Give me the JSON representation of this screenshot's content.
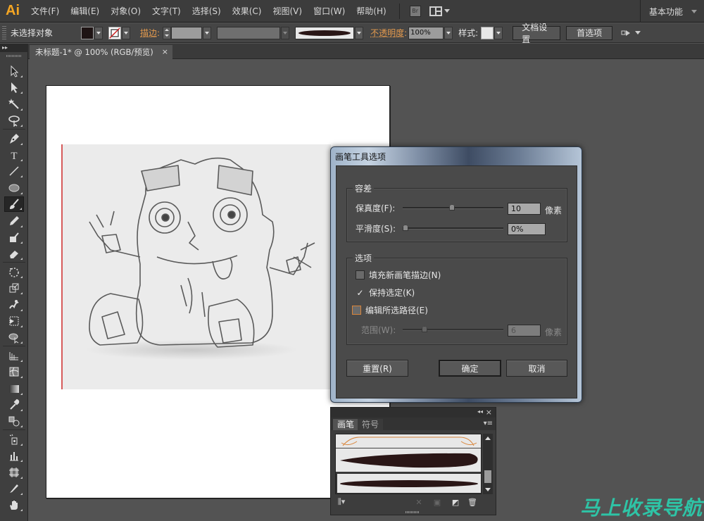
{
  "app": {
    "logo": "Ai"
  },
  "menu": {
    "items": [
      "文件(F)",
      "编辑(E)",
      "对象(O)",
      "文字(T)",
      "选择(S)",
      "效果(C)",
      "视图(V)",
      "窗口(W)",
      "帮助(H)"
    ],
    "bridge_label": "Br",
    "workspace": "基本功能"
  },
  "control_bar": {
    "selection_status": "未选择对象",
    "fill_color": "#1e1414",
    "stroke_label": "描边",
    "opacity_label": "不透明度",
    "opacity_value": "100%",
    "style_label": "样式",
    "doc_setup_button": "文档设置",
    "preferences_button": "首选项"
  },
  "document_tab": {
    "title": "未标题-1* @ 100% (RGB/预览)",
    "close": "×"
  },
  "tools": [
    {
      "name": "selection-tool"
    },
    {
      "name": "direct-selection-tool"
    },
    {
      "name": "magic-wand-tool"
    },
    {
      "name": "lasso-tool"
    },
    {
      "name": "pen-tool"
    },
    {
      "name": "type-tool"
    },
    {
      "name": "line-segment-tool"
    },
    {
      "name": "ellipse-tool"
    },
    {
      "name": "paintbrush-tool",
      "active": true
    },
    {
      "name": "pencil-tool"
    },
    {
      "name": "blob-brush-tool"
    },
    {
      "name": "eraser-tool"
    },
    {
      "name": "rotate-tool"
    },
    {
      "name": "scale-tool"
    },
    {
      "name": "warp-tool"
    },
    {
      "name": "free-transform-tool"
    },
    {
      "name": "shape-builder-tool"
    },
    {
      "name": "perspective-grid-tool"
    },
    {
      "name": "mesh-tool"
    },
    {
      "name": "gradient-tool"
    },
    {
      "name": "eyedropper-tool"
    },
    {
      "name": "blend-tool"
    },
    {
      "name": "symbol-sprayer-tool"
    },
    {
      "name": "column-graph-tool"
    },
    {
      "name": "artboard-tool"
    },
    {
      "name": "slice-tool"
    },
    {
      "name": "hand-tool"
    }
  ],
  "dialog": {
    "title": "画笔工具选项",
    "tolerance": {
      "title": "容差",
      "fidelity_label": "保真度(F):",
      "fidelity_value": "10",
      "fidelity_fraction": 0.49,
      "fidelity_unit": "像素",
      "smoothness_label": "平滑度(S):",
      "smoothness_value": "0%",
      "smoothness_fraction": 0.0
    },
    "options": {
      "title": "选项",
      "fill_new": {
        "label": "填充新画笔描边(N)",
        "checked": false
      },
      "keep_selected": {
        "label": "保持选定(K)",
        "checked": true,
        "mark": "✓"
      },
      "edit_selected": {
        "label": "编辑所选路径(E)",
        "checked": false
      },
      "within_label": "范围(W):",
      "within_value": "6",
      "within_fraction": 0.2,
      "within_unit": "像素"
    },
    "reset_button": "重置(R)",
    "ok_button": "确定",
    "cancel_button": "取消"
  },
  "brush_panel": {
    "collapse": "◂◂",
    "close": "×",
    "tabs": [
      "画笔",
      "符号"
    ],
    "menu": "▾≡",
    "brushes": [
      "calligraphic-loops",
      "tapered-stroke",
      "thin-oval-stroke"
    ],
    "selected_index": 2
  },
  "watermark": "马上收录导航"
}
